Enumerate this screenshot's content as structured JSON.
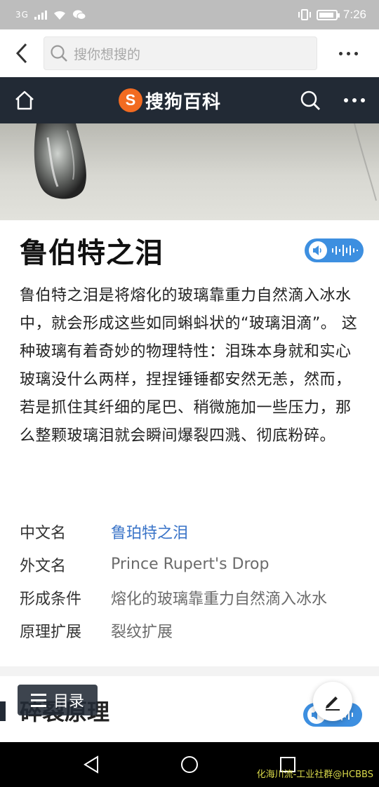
{
  "status_bar": {
    "network": "3G",
    "time": "7:26"
  },
  "browser": {
    "search_placeholder": "搜你想搜的"
  },
  "site": {
    "logo_letter": "S",
    "logo_text": "搜狗百科",
    "accent_color": "#f26b21",
    "header_bg": "#222a35"
  },
  "article": {
    "title": "鲁伯特之泪",
    "summary": "鲁伯特之泪是将熔化的玻璃靠重力自然滴入冰水中，就会形成这些如同蝌蚪状的“玻璃泪滴”。 这种玻璃有着奇妙的物理特性：泪珠本身就和实心玻璃没什么两样，捏捏锤锤都安然无恙，然而，若是抓住其纤细的尾巴、稍微施加一些压力，那么整颗玻璃泪就会瞬间爆裂四溅、彻底粉碎。",
    "infobox": [
      {
        "key": "中文名",
        "value": "鲁珀特之泪"
      },
      {
        "key": "外文名",
        "value": "Prince Rupert's Drop"
      },
      {
        "key": "形成条件",
        "value": "熔化的玻璃靠重力自然滴入冰水"
      },
      {
        "key": "原理扩展",
        "value": "裂纹扩展"
      }
    ],
    "section_title": "碎裂原理"
  },
  "toc": {
    "label": "目录"
  },
  "watermark": "化海川流-工业社群@HCBBS"
}
